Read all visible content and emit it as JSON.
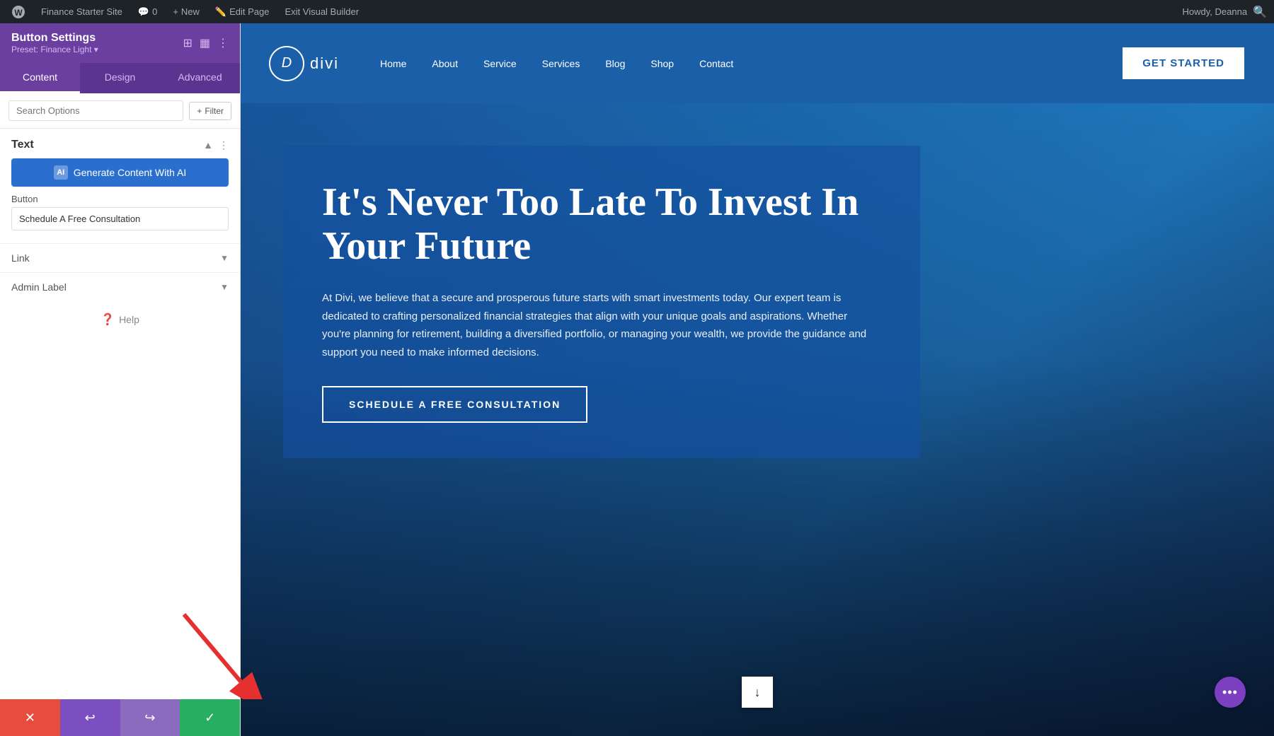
{
  "admin_bar": {
    "wp_label": "WordPress",
    "site_name": "Finance Starter Site",
    "comments_count": "0",
    "new_label": "New",
    "edit_label": "Edit Page",
    "exit_label": "Exit Visual Builder",
    "howdy": "Howdy, Deanna"
  },
  "sidebar": {
    "title": "Button Settings",
    "preset": "Preset: Finance Light ▾",
    "tabs": [
      {
        "label": "Content",
        "active": true
      },
      {
        "label": "Design",
        "active": false
      },
      {
        "label": "Advanced",
        "active": false
      }
    ],
    "search_placeholder": "Search Options",
    "filter_label": "+ Filter",
    "text_section": {
      "title": "Text",
      "ai_button_label": "Generate Content With AI",
      "ai_icon_label": "AI",
      "field_label": "Button",
      "field_value": "Schedule A Free Consultation"
    },
    "link_section": {
      "title": "Link"
    },
    "admin_label_section": {
      "title": "Admin Label"
    },
    "help_label": "Help",
    "bottom_buttons": {
      "cancel_icon": "✕",
      "undo_icon": "↩",
      "redo_icon": "↪",
      "save_icon": "✓"
    }
  },
  "site": {
    "logo_letter": "D",
    "logo_name": "divi",
    "nav_items": [
      "Home",
      "About",
      "Service",
      "Services",
      "Blog",
      "Shop",
      "Contact"
    ],
    "get_started": "GET STARTED",
    "hero": {
      "title": "It's Never Too Late To Invest In Your Future",
      "subtitle": "At Divi, we believe that a secure and prosperous future starts with smart investments today. Our expert team is dedicated to crafting personalized financial strategies that align with your unique goals and aspirations. Whether you're planning for retirement, building a diversified portfolio, or managing your wealth, we provide the guidance and support you need to make informed decisions.",
      "cta": "SCHEDULE A FREE CONSULTATION"
    }
  },
  "colors": {
    "sidebar_bg": "#6b3fa0",
    "sidebar_tab_active": "#6b3fa0",
    "ai_button": "#2b6fce",
    "cancel_btn": "#e74c3c",
    "undo_btn": "#7b4fbf",
    "redo_btn": "#8a6bbf",
    "save_btn": "#27ae60",
    "nav_bg": "#1a5fa8",
    "hero_bg": "#1a5fa8",
    "floating_menu": "#7b3fbf"
  }
}
